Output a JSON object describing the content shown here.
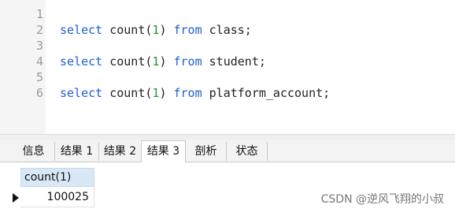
{
  "editor": {
    "line_numbers": [
      "1",
      "2",
      "3",
      "4",
      "5",
      "6"
    ],
    "lines": [
      {
        "kw1": "select",
        "fn": "count(",
        "num": "1",
        "close": ")",
        "kw2": "from",
        "table": "class;"
      },
      {
        "kw1": "select",
        "fn": "count(",
        "num": "1",
        "close": ")",
        "kw2": "from",
        "table": "student;"
      },
      {
        "kw1": "select",
        "fn": "count(",
        "num": "1",
        "close": ")",
        "kw2": "from",
        "table": "platform_account;"
      }
    ],
    "colors": {
      "keyword": "#1f5fd0",
      "number": "#1a9a2a"
    }
  },
  "tabs": [
    "信息",
    "结果 1",
    "结果 2",
    "结果 3",
    "剖析",
    "状态"
  ],
  "active_tab": "结果 3",
  "result": {
    "columns": [
      "count(1)"
    ],
    "rows": [
      [
        "100025"
      ]
    ],
    "row_indicator_icon": "current-row-arrow-icon"
  },
  "watermark": "CSDN @逆风飞翔的小叔"
}
